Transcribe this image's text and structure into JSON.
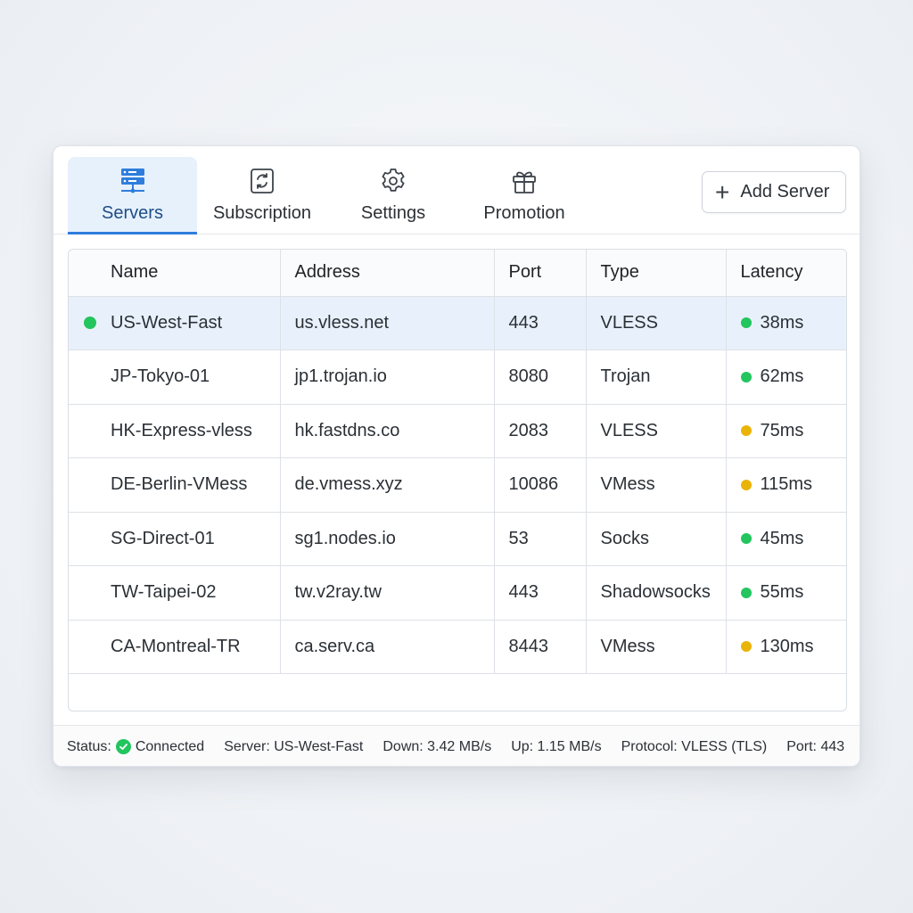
{
  "toolbar": {
    "tabs": [
      {
        "label": "Servers",
        "icon": "server-icon",
        "active": true
      },
      {
        "label": "Subscription",
        "icon": "sync-icon",
        "active": false
      },
      {
        "label": "Settings",
        "icon": "gear-icon",
        "active": false
      },
      {
        "label": "Promotion",
        "icon": "gift-icon",
        "active": false
      }
    ],
    "add_server_label": "Add Server"
  },
  "table": {
    "columns": [
      "Name",
      "Address",
      "Port",
      "Type",
      "Latency"
    ],
    "rows": [
      {
        "name": "US-West-Fast",
        "address": "us.vless.net",
        "port": "443",
        "type": "VLESS",
        "latency": "38ms",
        "latency_status": "green",
        "selected": true
      },
      {
        "name": "JP-Tokyo-01",
        "address": "jp1.trojan.io",
        "port": "8080",
        "type": "Trojan",
        "latency": "62ms",
        "latency_status": "green",
        "selected": false
      },
      {
        "name": "HK-Express-vless",
        "address": "hk.fastdns.co",
        "port": "2083",
        "type": "VLESS",
        "latency": "75ms",
        "latency_status": "yellow",
        "selected": false
      },
      {
        "name": "DE-Berlin-VMess",
        "address": "de.vmess.xyz",
        "port": "10086",
        "type": "VMess",
        "latency": "115ms",
        "latency_status": "yellow",
        "selected": false
      },
      {
        "name": "SG-Direct-01",
        "address": "sg1.nodes.io",
        "port": "53",
        "type": "Socks",
        "latency": "45ms",
        "latency_status": "green",
        "selected": false
      },
      {
        "name": "TW-Taipei-02",
        "address": "tw.v2ray.tw",
        "port": "443",
        "type": "Shadowsocks",
        "latency": "55ms",
        "latency_status": "green",
        "selected": false
      },
      {
        "name": "CA-Montreal-TR",
        "address": "ca.serv.ca",
        "port": "8443",
        "type": "VMess",
        "latency": "130ms",
        "latency_status": "yellow",
        "selected": false
      }
    ]
  },
  "status_bar": {
    "status_label": "Status:",
    "status_value": "Connected",
    "server": "Server: US-West-Fast",
    "down": "Down: 3.42 MB/s",
    "up": "Up: 1.15 MB/s",
    "protocol": "Protocol: VLESS (TLS)",
    "port": "Port: 443"
  },
  "colors": {
    "accent": "#2f7ddc",
    "selected_row": "#e8f1fb",
    "green": "#22c55e",
    "yellow": "#eab308"
  }
}
